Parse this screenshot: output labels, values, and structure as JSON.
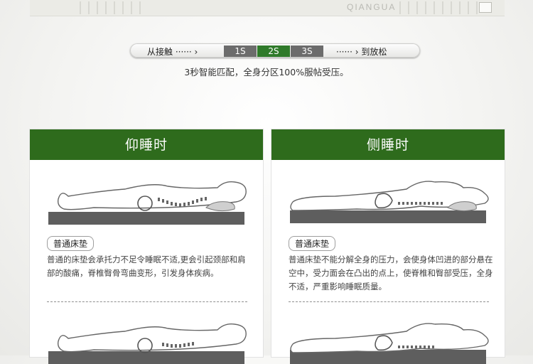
{
  "brand": {
    "logo_text": "QIANGUA"
  },
  "pressure_bar": {
    "start_label": "从接触 ······ ›",
    "steps": [
      "1S",
      "2S",
      "3S"
    ],
    "end_label": "······ ›  到放松",
    "active_step": "2S"
  },
  "caption": "3秒智能匹配，全身分区100%服帖受压。",
  "panels": [
    {
      "title": "仰睡时",
      "tag": "普通床垫",
      "description": "普通的床垫会承托力不足令睡眠不适,更会引起颈部和肩部的酸痛，脊椎臀骨弯曲变形，引发身体疾病。"
    },
    {
      "title": "侧睡时",
      "tag": "普通床垫",
      "description": "普通床垫不能分解全身的压力，会使身体凹进的部分悬在空中，受力面会在凸出的点上，使脊椎和臀部受压，全身不适，严重影响睡眠质量。"
    }
  ],
  "colors": {
    "accent_green": "#2e6b1c",
    "segment_gray": "#6c6c6c",
    "segment_active": "#2f7a2a"
  }
}
